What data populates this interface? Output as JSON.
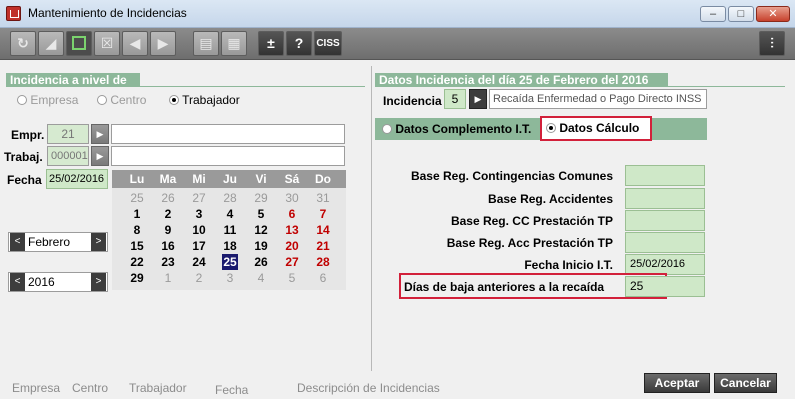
{
  "window": {
    "title": "Mantenimiento de Incidencias"
  },
  "toolbar": {
    "plus_minus_label": "±",
    "help_label": "?",
    "ciss_label": "CISS"
  },
  "left": {
    "header": "Incidencia a nivel de",
    "level_options": [
      "Empresa",
      "Centro",
      "Trabajador"
    ],
    "empr_label": "Empr.",
    "empr_value": "21",
    "trabaj_label": "Trabaj.",
    "trabaj_value": "000001",
    "fecha_label": "Fecha",
    "fecha_value": "25/02/2016",
    "month_value": "Febrero",
    "year_value": "2016",
    "calendar": {
      "weekdays": [
        "Lu",
        "Ma",
        "Mi",
        "Ju",
        "Vi",
        "Sá",
        "Do"
      ],
      "weeks": [
        [
          "25",
          "26",
          "27",
          "28",
          "29",
          "30",
          "31"
        ],
        [
          "1",
          "2",
          "3",
          "4",
          "5",
          "6",
          "7"
        ],
        [
          "8",
          "9",
          "10",
          "11",
          "12",
          "13",
          "14"
        ],
        [
          "15",
          "16",
          "17",
          "18",
          "19",
          "20",
          "21"
        ],
        [
          "22",
          "23",
          "24",
          "25",
          "26",
          "27",
          "28"
        ],
        [
          "29",
          "1",
          "2",
          "3",
          "4",
          "5",
          "6"
        ]
      ],
      "selected": "25"
    }
  },
  "right": {
    "header": "Datos Incidencia del día 25 de Febrero del 2016",
    "incidencia_label": "Incidencia",
    "incidencia_code": "5",
    "incidencia_desc": "Recaída Enfermedad o Pago Directo INSS",
    "option_complemento": "Datos Complemento I.T.",
    "option_calculo": "Datos Cálculo",
    "fields": [
      {
        "label": "Base Reg. Contingencias Comunes",
        "value": ""
      },
      {
        "label": "Base Reg. Accidentes",
        "value": ""
      },
      {
        "label": "Base Reg. CC Prestación TP",
        "value": ""
      },
      {
        "label": "Base Reg. Acc Prestación TP",
        "value": ""
      },
      {
        "label": "Fecha Inicio I.T.",
        "value": "25/02/2016"
      },
      {
        "label": "Días de baja anteriores a la recaída",
        "value": "25"
      }
    ]
  },
  "footer": {
    "columns": [
      "Empresa",
      "Centro",
      "Trabajador",
      "Fecha",
      "Descripción de Incidencias"
    ],
    "accept_label": "Aceptar",
    "cancel_label": "Cancelar"
  },
  "colors": {
    "accent_green": "#8db89a",
    "highlight_red": "#d2203a",
    "selected_day": "#1a1a6e",
    "weekend_red": "#c00000"
  }
}
